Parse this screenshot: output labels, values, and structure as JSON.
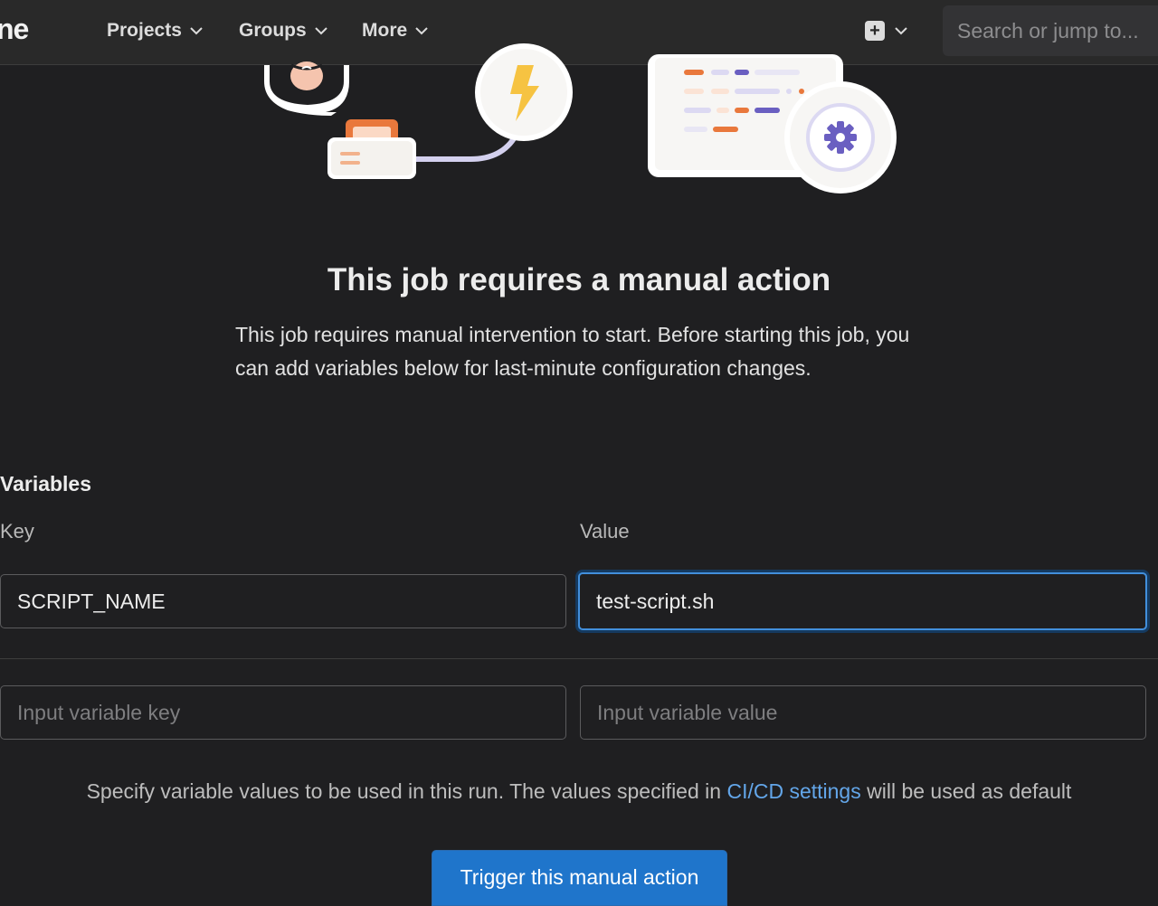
{
  "topbar": {
    "logo_fragment": "ne",
    "nav": [
      {
        "label": "Projects"
      },
      {
        "label": "Groups"
      },
      {
        "label": "More"
      }
    ],
    "new_icon": "plus-square-icon",
    "search_placeholder": "Search or jump to..."
  },
  "main": {
    "title": "This job requires a manual action",
    "description": "This job requires manual intervention to start. Before starting this job, you can add variables below for last-minute configuration changes.",
    "variables_heading": "Variables",
    "key_label": "Key",
    "value_label": "Value",
    "rows": [
      {
        "key": "SCRIPT_NAME",
        "value": "test-script.sh"
      }
    ],
    "new_key_placeholder": "Input variable key",
    "new_value_placeholder": "Input variable value",
    "help_before": "Specify variable values to be used in this run. The values specified in ",
    "help_link": "CI/CD settings",
    "help_after": " will be used as default",
    "trigger_label": "Trigger this manual action"
  },
  "colors": {
    "background": "#1f1f21",
    "topbar": "#292929",
    "primary": "#1f75cb",
    "link": "#63a6e9",
    "focus": "#428fdc"
  }
}
